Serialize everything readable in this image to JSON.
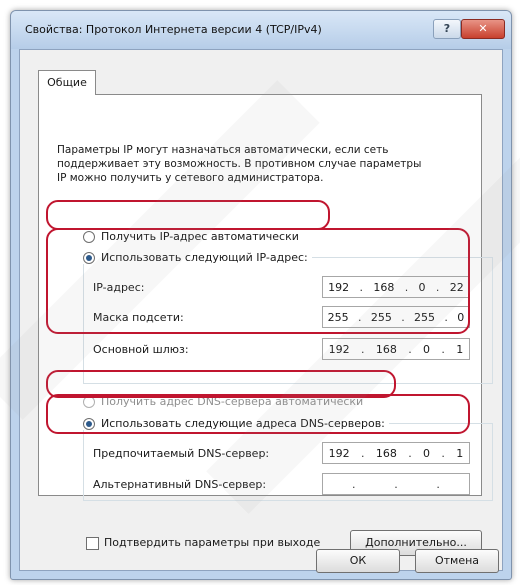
{
  "window": {
    "title": "Свойства: Протокол Интернета версии 4 (TCP/IPv4)",
    "help_glyph": "?",
    "close_glyph": "✕"
  },
  "tab": {
    "label": "Общие"
  },
  "description": "Параметры IP могут назначаться автоматически, если сеть\nподдерживает эту возможность. В противном случае параметры\nIP можно получить у сетевого администратора.",
  "ip_section": {
    "auto_label": "Получить IP-адрес автоматически",
    "manual_label": "Использовать следующий IP-адрес:",
    "fields": [
      {
        "label": "IP-адрес:",
        "octets": [
          "192",
          "168",
          "0",
          "22"
        ]
      },
      {
        "label": "Маска подсети:",
        "octets": [
          "255",
          "255",
          "255",
          "0"
        ]
      },
      {
        "label": "Основной шлюз:",
        "octets": [
          "192",
          "168",
          "0",
          "1"
        ]
      }
    ]
  },
  "dns_section": {
    "auto_label": "Получить адрес DNS-сервера автоматически",
    "manual_label": "Использовать следующие адреса DNS-серверов:",
    "preferred": {
      "label": "Предпочитаемый DNS-сервер:",
      "octets": [
        "192",
        "168",
        "0",
        "1"
      ]
    },
    "alternate": {
      "label": "Альтернативный DNS-сервер:",
      "octets": [
        "",
        "",
        "",
        ""
      ]
    }
  },
  "validate_label": "Подтвердить параметры при выходе",
  "advanced_button": "Дополнительно...",
  "ok_button": "ОК",
  "cancel_button": "Отмена",
  "colors": {
    "highlight": "#c0152f",
    "title_bg": "#bdd3ec",
    "panel_bg": "#f0f0f0"
  }
}
